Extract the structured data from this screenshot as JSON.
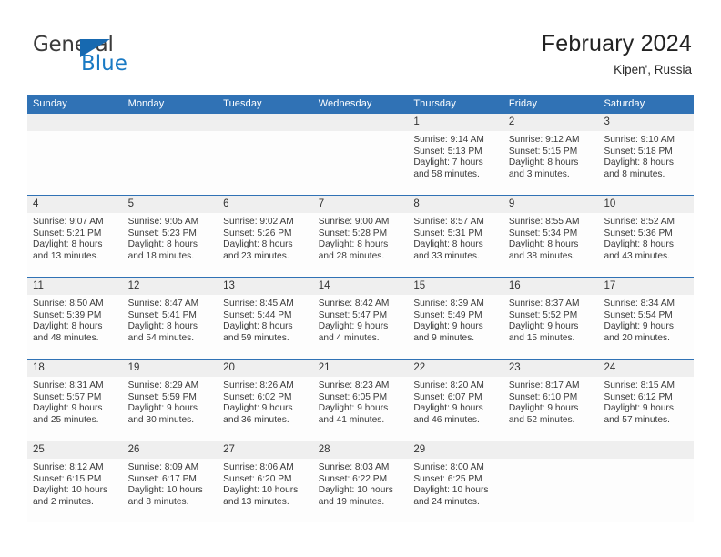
{
  "brand": {
    "word_top": "General",
    "word_bottom": "Blue",
    "flag_icon": "blue-triangle-flag",
    "color_blue": "#1a7ac4",
    "color_text": "#3b3b3b"
  },
  "header": {
    "title": "February 2024",
    "subtitle": "Kipen', Russia"
  },
  "theme": {
    "header_blue": "#3072b5",
    "daynum_band_gray": "#efefef",
    "body_text": "#3a3a3a"
  },
  "weekdays": [
    "Sunday",
    "Monday",
    "Tuesday",
    "Wednesday",
    "Thursday",
    "Friday",
    "Saturday"
  ],
  "weeks": [
    [
      {
        "day": "",
        "lines": []
      },
      {
        "day": "",
        "lines": []
      },
      {
        "day": "",
        "lines": []
      },
      {
        "day": "",
        "lines": []
      },
      {
        "day": "1",
        "lines": [
          "Sunrise: 9:14 AM",
          "Sunset: 5:13 PM",
          "Daylight: 7 hours",
          "and 58 minutes."
        ]
      },
      {
        "day": "2",
        "lines": [
          "Sunrise: 9:12 AM",
          "Sunset: 5:15 PM",
          "Daylight: 8 hours",
          "and 3 minutes."
        ]
      },
      {
        "day": "3",
        "lines": [
          "Sunrise: 9:10 AM",
          "Sunset: 5:18 PM",
          "Daylight: 8 hours",
          "and 8 minutes."
        ]
      }
    ],
    [
      {
        "day": "4",
        "lines": [
          "Sunrise: 9:07 AM",
          "Sunset: 5:21 PM",
          "Daylight: 8 hours",
          "and 13 minutes."
        ]
      },
      {
        "day": "5",
        "lines": [
          "Sunrise: 9:05 AM",
          "Sunset: 5:23 PM",
          "Daylight: 8 hours",
          "and 18 minutes."
        ]
      },
      {
        "day": "6",
        "lines": [
          "Sunrise: 9:02 AM",
          "Sunset: 5:26 PM",
          "Daylight: 8 hours",
          "and 23 minutes."
        ]
      },
      {
        "day": "7",
        "lines": [
          "Sunrise: 9:00 AM",
          "Sunset: 5:28 PM",
          "Daylight: 8 hours",
          "and 28 minutes."
        ]
      },
      {
        "day": "8",
        "lines": [
          "Sunrise: 8:57 AM",
          "Sunset: 5:31 PM",
          "Daylight: 8 hours",
          "and 33 minutes."
        ]
      },
      {
        "day": "9",
        "lines": [
          "Sunrise: 8:55 AM",
          "Sunset: 5:34 PM",
          "Daylight: 8 hours",
          "and 38 minutes."
        ]
      },
      {
        "day": "10",
        "lines": [
          "Sunrise: 8:52 AM",
          "Sunset: 5:36 PM",
          "Daylight: 8 hours",
          "and 43 minutes."
        ]
      }
    ],
    [
      {
        "day": "11",
        "lines": [
          "Sunrise: 8:50 AM",
          "Sunset: 5:39 PM",
          "Daylight: 8 hours",
          "and 48 minutes."
        ]
      },
      {
        "day": "12",
        "lines": [
          "Sunrise: 8:47 AM",
          "Sunset: 5:41 PM",
          "Daylight: 8 hours",
          "and 54 minutes."
        ]
      },
      {
        "day": "13",
        "lines": [
          "Sunrise: 8:45 AM",
          "Sunset: 5:44 PM",
          "Daylight: 8 hours",
          "and 59 minutes."
        ]
      },
      {
        "day": "14",
        "lines": [
          "Sunrise: 8:42 AM",
          "Sunset: 5:47 PM",
          "Daylight: 9 hours",
          "and 4 minutes."
        ]
      },
      {
        "day": "15",
        "lines": [
          "Sunrise: 8:39 AM",
          "Sunset: 5:49 PM",
          "Daylight: 9 hours",
          "and 9 minutes."
        ]
      },
      {
        "day": "16",
        "lines": [
          "Sunrise: 8:37 AM",
          "Sunset: 5:52 PM",
          "Daylight: 9 hours",
          "and 15 minutes."
        ]
      },
      {
        "day": "17",
        "lines": [
          "Sunrise: 8:34 AM",
          "Sunset: 5:54 PM",
          "Daylight: 9 hours",
          "and 20 minutes."
        ]
      }
    ],
    [
      {
        "day": "18",
        "lines": [
          "Sunrise: 8:31 AM",
          "Sunset: 5:57 PM",
          "Daylight: 9 hours",
          "and 25 minutes."
        ]
      },
      {
        "day": "19",
        "lines": [
          "Sunrise: 8:29 AM",
          "Sunset: 5:59 PM",
          "Daylight: 9 hours",
          "and 30 minutes."
        ]
      },
      {
        "day": "20",
        "lines": [
          "Sunrise: 8:26 AM",
          "Sunset: 6:02 PM",
          "Daylight: 9 hours",
          "and 36 minutes."
        ]
      },
      {
        "day": "21",
        "lines": [
          "Sunrise: 8:23 AM",
          "Sunset: 6:05 PM",
          "Daylight: 9 hours",
          "and 41 minutes."
        ]
      },
      {
        "day": "22",
        "lines": [
          "Sunrise: 8:20 AM",
          "Sunset: 6:07 PM",
          "Daylight: 9 hours",
          "and 46 minutes."
        ]
      },
      {
        "day": "23",
        "lines": [
          "Sunrise: 8:17 AM",
          "Sunset: 6:10 PM",
          "Daylight: 9 hours",
          "and 52 minutes."
        ]
      },
      {
        "day": "24",
        "lines": [
          "Sunrise: 8:15 AM",
          "Sunset: 6:12 PM",
          "Daylight: 9 hours",
          "and 57 minutes."
        ]
      }
    ],
    [
      {
        "day": "25",
        "lines": [
          "Sunrise: 8:12 AM",
          "Sunset: 6:15 PM",
          "Daylight: 10 hours",
          "and 2 minutes."
        ]
      },
      {
        "day": "26",
        "lines": [
          "Sunrise: 8:09 AM",
          "Sunset: 6:17 PM",
          "Daylight: 10 hours",
          "and 8 minutes."
        ]
      },
      {
        "day": "27",
        "lines": [
          "Sunrise: 8:06 AM",
          "Sunset: 6:20 PM",
          "Daylight: 10 hours",
          "and 13 minutes."
        ]
      },
      {
        "day": "28",
        "lines": [
          "Sunrise: 8:03 AM",
          "Sunset: 6:22 PM",
          "Daylight: 10 hours",
          "and 19 minutes."
        ]
      },
      {
        "day": "29",
        "lines": [
          "Sunrise: 8:00 AM",
          "Sunset: 6:25 PM",
          "Daylight: 10 hours",
          "and 24 minutes."
        ]
      },
      {
        "day": "",
        "lines": []
      },
      {
        "day": "",
        "lines": []
      }
    ]
  ]
}
